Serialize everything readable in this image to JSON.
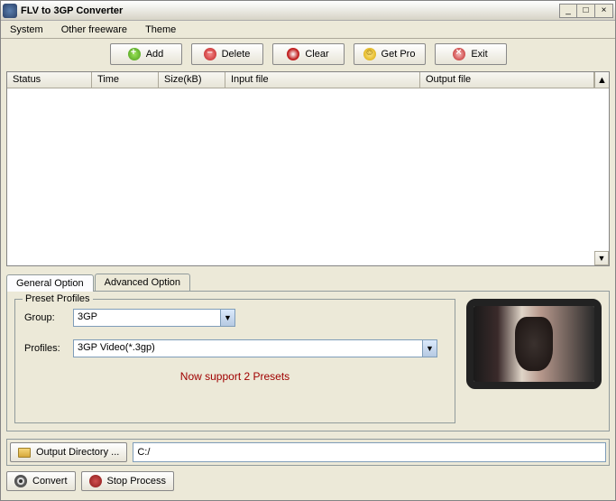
{
  "window": {
    "title": "FLV to 3GP Converter"
  },
  "menu": {
    "system": "System",
    "other": "Other freeware",
    "theme": "Theme"
  },
  "toolbar": {
    "add": "Add",
    "delete": "Delete",
    "clear": "Clear",
    "getpro": "Get Pro",
    "exit": "Exit"
  },
  "columns": {
    "status": "Status",
    "time": "Time",
    "size": "Size(kB)",
    "input": "Input file",
    "output": "Output file"
  },
  "tabs": {
    "general": "General Option",
    "advanced": "Advanced Option"
  },
  "preset": {
    "legend": "Preset Profiles",
    "grouplabel": "Group:",
    "group": "3GP",
    "profileslabel": "Profiles:",
    "profiles": "3GP Video(*.3gp)",
    "support": "Now support 2 Presets"
  },
  "output": {
    "btn": "Output Directory ...",
    "path": "C:/"
  },
  "bottom": {
    "convert": "Convert",
    "stop": "Stop Process"
  }
}
